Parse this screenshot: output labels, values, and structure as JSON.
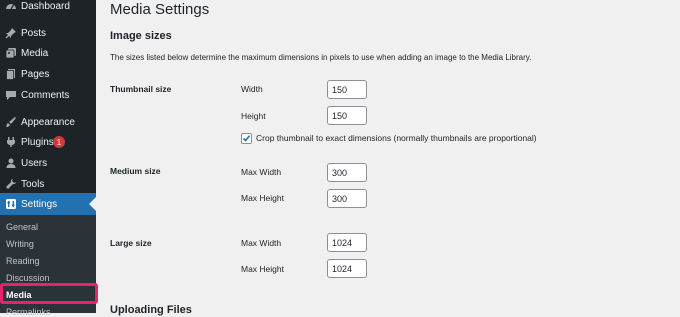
{
  "sidebar": {
    "items": [
      {
        "label": "Dashboard",
        "icon": "dashboard-icon"
      },
      {
        "label": "Posts",
        "icon": "pin-icon"
      },
      {
        "label": "Media",
        "icon": "media-icon"
      },
      {
        "label": "Pages",
        "icon": "pages-icon"
      },
      {
        "label": "Comments",
        "icon": "comments-icon"
      },
      {
        "label": "Appearance",
        "icon": "brush-icon"
      },
      {
        "label": "Plugins",
        "icon": "plugin-icon",
        "badge": "1"
      },
      {
        "label": "Users",
        "icon": "users-icon"
      },
      {
        "label": "Tools",
        "icon": "wrench-icon"
      },
      {
        "label": "Settings",
        "icon": "settings-icon",
        "active": true
      }
    ],
    "submenu": [
      "General",
      "Writing",
      "Reading",
      "Discussion",
      "Media",
      "Permalinks"
    ],
    "current_submenu": "Media"
  },
  "page": {
    "title": "Media Settings",
    "section_image_sizes": "Image sizes",
    "description": "The sizes listed below determine the maximum dimensions in pixels to use when adding an image to the Media Library.",
    "thumbnail": {
      "label": "Thumbnail size",
      "width_label": "Width",
      "width_value": "150",
      "height_label": "Height",
      "height_value": "150",
      "crop_label": "Crop thumbnail to exact dimensions (normally thumbnails are proportional)",
      "crop_checked": true
    },
    "medium": {
      "label": "Medium size",
      "width_label": "Max Width",
      "width_value": "300",
      "height_label": "Max Height",
      "height_value": "300"
    },
    "large": {
      "label": "Large size",
      "width_label": "Max Width",
      "width_value": "1024",
      "height_label": "Max Height",
      "height_value": "1024"
    },
    "section_uploading": "Uploading Files"
  },
  "colors": {
    "sidebar_bg": "#1d2327",
    "submenu_bg": "#2c3338",
    "accent": "#2271b1",
    "badge": "#d63638",
    "highlight": "#e6246e"
  }
}
